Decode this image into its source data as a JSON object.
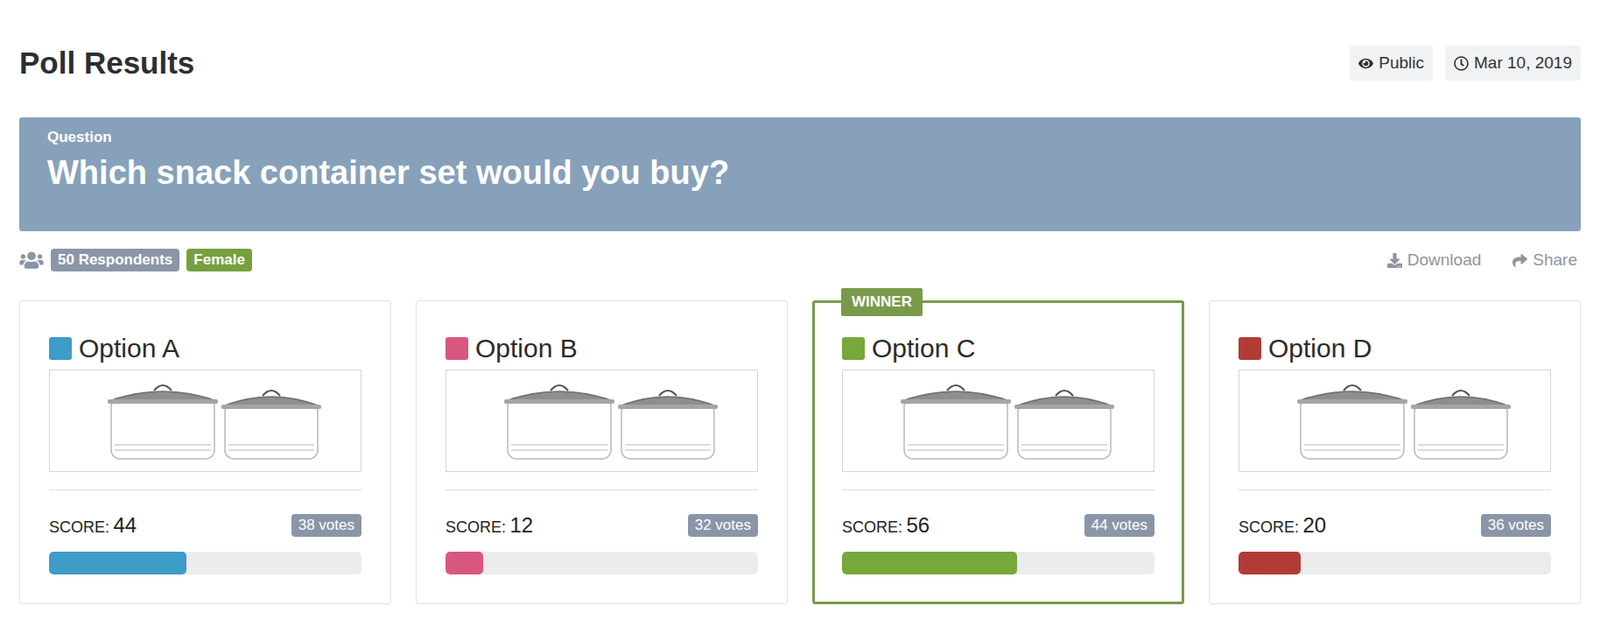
{
  "title": "Poll Results",
  "meta": [
    {
      "icon": "eye",
      "label": "Public"
    },
    {
      "icon": "clock",
      "label": "Mar 10, 2019"
    }
  ],
  "question": {
    "label": "Question",
    "text": "Which snack container set would you buy?"
  },
  "filters": [
    {
      "label": "50 Respondents",
      "color": "#8a96a8"
    },
    {
      "label": "Female",
      "color": "#76a03f"
    }
  ],
  "actions": [
    {
      "icon": "download",
      "label": "Download"
    },
    {
      "icon": "share",
      "label": "Share"
    }
  ],
  "winner_badge": "WINNER",
  "options": [
    {
      "name": "Option A",
      "score_label": "SCORE:",
      "score": "44",
      "votes": "38 votes",
      "level": 0.44,
      "color": "#3d9cc8",
      "winner": false
    },
    {
      "name": "Option B",
      "score_label": "SCORE:",
      "score": "12",
      "votes": "32 votes",
      "level": 0.12,
      "color": "#d9577f",
      "winner": false
    },
    {
      "name": "Option C",
      "score_label": "SCORE:",
      "score": "56",
      "votes": "44 votes",
      "level": 0.56,
      "color": "#76a83a",
      "winner": true
    },
    {
      "name": "Option D",
      "score_label": "SCORE:",
      "score": "20",
      "votes": "36 votes",
      "level": 0.2,
      "color": "#b23b36",
      "winner": false
    }
  ]
}
